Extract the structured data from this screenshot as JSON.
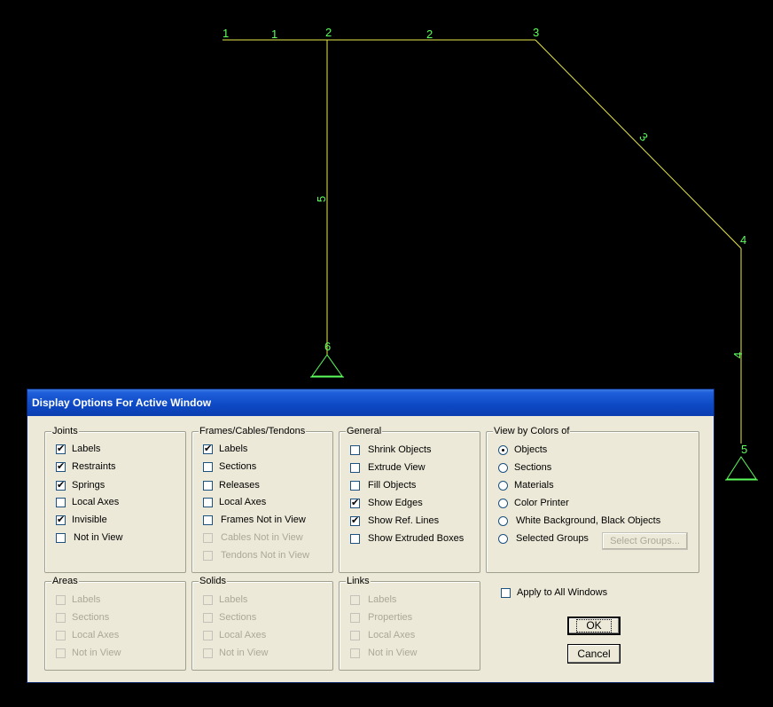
{
  "drawing": {
    "joints": [
      "1",
      "2",
      "3",
      "4",
      "5",
      "6"
    ],
    "frames": [
      "1",
      "2",
      "3",
      "4",
      "5"
    ],
    "line_color": "#e8e84a",
    "label_color": "#5cff5c"
  },
  "dialog": {
    "title": "Display Options For Active Window",
    "joints": {
      "legend": "Joints",
      "options": [
        {
          "label": "Labels",
          "checked": true
        },
        {
          "label": "Restraints",
          "checked": true
        },
        {
          "label": "Springs",
          "checked": true
        },
        {
          "label": "Local Axes",
          "checked": false
        },
        {
          "label": "Invisible",
          "checked": true
        },
        {
          "label": "Not in View",
          "checked": false
        }
      ]
    },
    "frames": {
      "legend": "Frames/Cables/Tendons",
      "options": [
        {
          "label": "Labels",
          "checked": true,
          "enabled": true
        },
        {
          "label": "Sections",
          "checked": false,
          "enabled": true
        },
        {
          "label": "Releases",
          "checked": false,
          "enabled": true
        },
        {
          "label": "Local Axes",
          "checked": false,
          "enabled": true
        },
        {
          "label": "Frames Not in View",
          "checked": false,
          "enabled": true
        },
        {
          "label": "Cables Not in View",
          "checked": false,
          "enabled": false
        },
        {
          "label": "Tendons Not in View",
          "checked": false,
          "enabled": false
        }
      ]
    },
    "general": {
      "legend": "General",
      "options": [
        {
          "label": "Shrink Objects",
          "checked": false
        },
        {
          "label": "Extrude View",
          "checked": false
        },
        {
          "label": "Fill Objects",
          "checked": false
        },
        {
          "label": "Show Edges",
          "checked": true
        },
        {
          "label": "Show Ref. Lines",
          "checked": true
        },
        {
          "label": "Show Extruded Boxes",
          "checked": false
        }
      ]
    },
    "colors": {
      "legend": "View by Colors of",
      "options": [
        {
          "label": "Objects",
          "selected": true
        },
        {
          "label": "Sections",
          "selected": false
        },
        {
          "label": "Materials",
          "selected": false
        },
        {
          "label": "Color Printer",
          "selected": false
        },
        {
          "label": "White Background, Black Objects",
          "selected": false
        },
        {
          "label": "Selected Groups",
          "selected": false
        }
      ],
      "select_groups_label": "Select Groups..."
    },
    "areas": {
      "legend": "Areas",
      "options": [
        "Labels",
        "Sections",
        "Local Axes",
        "Not in View"
      ]
    },
    "solids": {
      "legend": "Solids",
      "options": [
        "Labels",
        "Sections",
        "Local Axes",
        "Not in View"
      ]
    },
    "links": {
      "legend": "Links",
      "options": [
        "Labels",
        "Properties",
        "Local Axes",
        "Not in View"
      ]
    },
    "apply_all": {
      "label": "Apply to All Windows",
      "checked": false
    },
    "ok_label": "OK",
    "cancel_label": "Cancel"
  }
}
